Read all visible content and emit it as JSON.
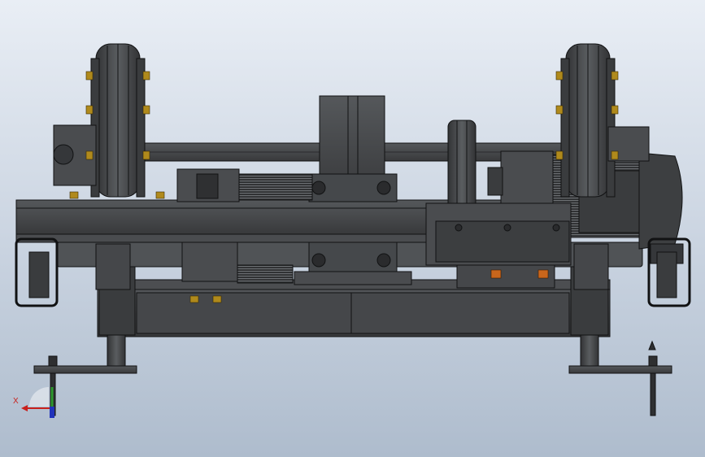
{
  "viewport": {
    "background_top": "#e9eef5",
    "background_bottom": "#aebccd",
    "model_color": "#3f4143",
    "edge_color": "#111213",
    "bolt_color": "#b08a1c",
    "accent_orange": "#c9661c"
  },
  "triad": {
    "x_label": "X",
    "x_color": "#c8201c",
    "y_color": "#2e9a2e",
    "z_color": "#2233bb"
  }
}
